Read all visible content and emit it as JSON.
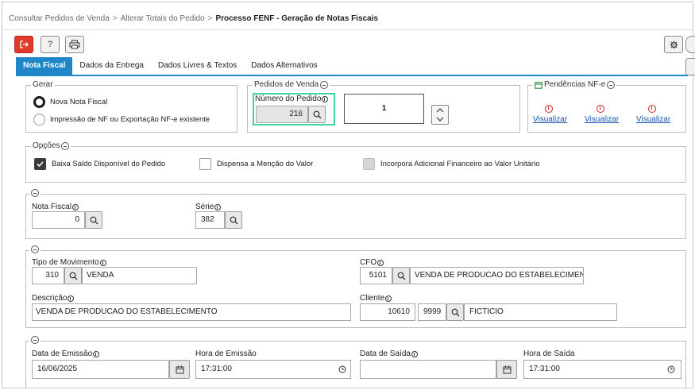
{
  "breadcrumb": {
    "items": [
      "Consultar Pedidos de Venda",
      "Alterar Totais do Pedido"
    ],
    "separator": ">",
    "current": "Processo FENF - Geração de Notas Fiscais"
  },
  "toolbar": {
    "exit_icon": "exit-icon",
    "help_label": "?",
    "print_icon": "printer-icon",
    "settings_icon": "gear-icon"
  },
  "tabs": [
    {
      "label": "Nota Fiscal",
      "active": true
    },
    {
      "label": "Dados da Entrega",
      "active": false
    },
    {
      "label": "Dados Livres & Textos",
      "active": false
    },
    {
      "label": "Dados Alternativos",
      "active": false
    }
  ],
  "gerar": {
    "legend": "Gerar",
    "options": [
      {
        "label": "Nova Nota Fiscal",
        "selected": true
      },
      {
        "label": "Impressão de NF ou Exportação NF-e existente",
        "selected": false
      }
    ]
  },
  "pedidos": {
    "legend": "Pedidos de Venda",
    "numero_label": "Número do Pedido",
    "numero_value": "216",
    "quantity_value": "1"
  },
  "pendencias": {
    "legend": "Pendências NF-e",
    "links": [
      "Visualizar",
      "Visualizar",
      "Visualizar"
    ]
  },
  "opcoes": {
    "legend": "Opções",
    "items": [
      {
        "label": "Baixa Saldo Disponível do Pedido",
        "checked": true
      },
      {
        "label": "Dispensa a Menção do Valor",
        "checked": false
      },
      {
        "label": "Incorpora Adicional Financeiro ao Valor Unitário",
        "checked": false,
        "disabled": true
      }
    ]
  },
  "nota": {
    "nota_fiscal_label": "Nota Fiscal",
    "nota_fiscal_value": "0",
    "serie_label": "Série",
    "serie_value": "382"
  },
  "movimento": {
    "tipo_label": "Tipo de Movimento",
    "tipo_code": "310",
    "tipo_desc": "VENDA",
    "cfo_label": "CFO",
    "cfo_code": "5101",
    "cfo_desc": "VENDA DE PRODUCAO DO ESTABELECIMENTO",
    "descricao_label": "Descrição",
    "descricao_value": "VENDA DE PRODUCAO DO ESTABELECIMENTO",
    "cliente_label": "Cliente",
    "cliente_code1": "10610",
    "cliente_code2": "9999",
    "cliente_name": "FICTICIO"
  },
  "datas": {
    "emissao_label": "Data de Emissão",
    "emissao_value": "16/06/2025",
    "hora_emissao_label": "Hora de Emissão",
    "hora_emissao_value": "17:31:00",
    "saida_label": "Data de Saída",
    "saida_value": "",
    "hora_saida_label": "Hora de Saída",
    "hora_saida_value": "17:31:00"
  },
  "colors": {
    "accent": "#1f86c7",
    "exit_button": "#e03a2b",
    "focus_border": "#3fd3a6",
    "warning": "#d32020",
    "link": "#1a55b0",
    "pendencias_icon": "#2a9d3a"
  }
}
